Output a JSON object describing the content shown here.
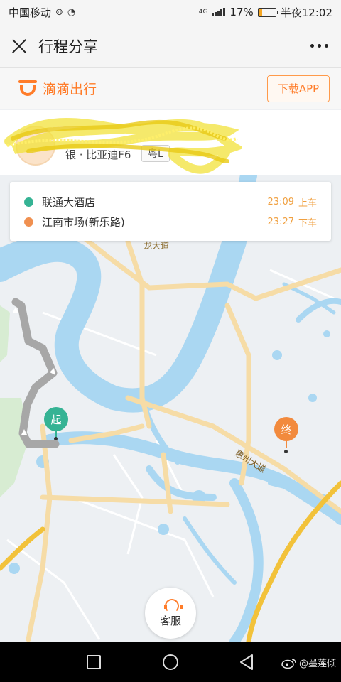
{
  "status_bar": {
    "carrier": "中国移动",
    "network": "4G",
    "battery": "17%",
    "battery_level": 0.17,
    "time": "半夜12:02"
  },
  "title_bar": {
    "title": "行程分享"
  },
  "brand_bar": {
    "app_name": "滴滴出行",
    "download_label": "下载APP",
    "brand_color": "#ff7c29"
  },
  "driver": {
    "car_model": "银 · 比亚迪F6",
    "plate": "粤L"
  },
  "trip": {
    "stops": [
      {
        "name": "联通大酒店",
        "time": "23:09",
        "action": "上车",
        "color": "#35b394"
      },
      {
        "name": "江南市场(新乐路)",
        "time": "23:27",
        "action": "下车",
        "color": "#f09050"
      }
    ]
  },
  "map": {
    "road_labels": [
      "龙大道",
      "惠州大道"
    ],
    "start_marker": "起",
    "end_marker": "终",
    "route_color": "#a7a7a7",
    "river_color": "#aad7f2",
    "road_color": "#f6dca6",
    "highway_color": "#f2c23a"
  },
  "service": {
    "label": "客服"
  },
  "watermark": {
    "text": "@墨莲倾"
  }
}
